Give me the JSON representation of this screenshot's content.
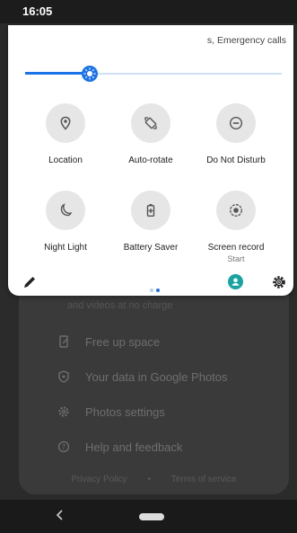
{
  "status_bar": {
    "time": "16:05"
  },
  "quick_settings": {
    "carrier_text": "s, Emergency calls",
    "brightness": {
      "level": 0.25
    },
    "tiles": [
      {
        "id": "location",
        "label": "Location",
        "sublabel": "",
        "icon": "location-pin-icon"
      },
      {
        "id": "auto-rotate",
        "label": "Auto-rotate",
        "sublabel": "",
        "icon": "rotate-icon"
      },
      {
        "id": "do-not-disturb",
        "label": "Do Not Disturb",
        "sublabel": "",
        "icon": "minus-circle-icon"
      },
      {
        "id": "night-light",
        "label": "Night Light",
        "sublabel": "",
        "icon": "moon-icon"
      },
      {
        "id": "battery-saver",
        "label": "Battery Saver",
        "sublabel": "",
        "icon": "battery-plus-icon"
      },
      {
        "id": "screen-record",
        "label": "Screen record",
        "sublabel": "Start",
        "icon": "record-icon"
      }
    ],
    "page_dots": {
      "count": 2,
      "active_index": 1
    },
    "accent_color": "#1a73e8",
    "user_color": "#1aa3a3"
  },
  "background_app": {
    "faint_text": "and videos at no charge",
    "menu_items": [
      {
        "label": "Free up space",
        "icon": "phone-broom-icon"
      },
      {
        "label": "Your data in Google Photos",
        "icon": "shield-icon"
      },
      {
        "label": "Photos settings",
        "icon": "gear-icon"
      },
      {
        "label": "Help and feedback",
        "icon": "help-icon"
      }
    ],
    "footer": {
      "privacy": "Privacy Policy",
      "separator": "•",
      "terms": "Terms of service"
    }
  },
  "nav_bar": {
    "back_icon": "back-chevron-icon",
    "home_icon": "home-pill-icon"
  }
}
